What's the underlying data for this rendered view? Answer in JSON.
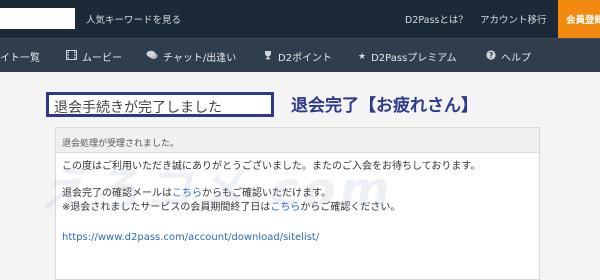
{
  "header": {
    "search": {
      "value": "",
      "placeholder": ""
    },
    "popular_keywords": "人気キーワードを見る",
    "about": "D2Passとは？",
    "account_migration": "アカウント移行",
    "register": "会員登録"
  },
  "nav": {
    "items": [
      {
        "label": "イト一覧",
        "icon": "list-icon"
      },
      {
        "label": "ムービー",
        "icon": "film-icon"
      },
      {
        "label": "チャット/出逢い",
        "icon": "chat-icon"
      },
      {
        "label": "D2ポイント",
        "icon": "trophy-icon"
      },
      {
        "label": "D2Passプレミアム",
        "icon": "star-icon"
      },
      {
        "label": "ヘルプ",
        "icon": "question-icon"
      }
    ]
  },
  "main": {
    "title_box": "退会手続きが完了しました",
    "caption": "退会完了【お疲れさん】",
    "watermark": "えろコメ.com",
    "panel": {
      "header": "退会処理が受理されました。",
      "line1": "この度はご利用いただき誠にありがとうございました。またのご入会をお待ちしております。",
      "line2_before": "退会完了の確認メールは",
      "line2_link": "こちら",
      "line2_after": "からもご確認いただけます。",
      "line3_before": "※退会されましたサービスの会員期間終了日は",
      "line3_link": "こちら",
      "line3_after": "からご確認ください。",
      "url": "https://www.d2pass.com/account/download/sitelist/"
    }
  },
  "colors": {
    "topbar": "#1c2936",
    "navbar": "#2f3d4c",
    "register": "#f28a0f",
    "accent": "#2d3a8c",
    "link": "#2a6ab8"
  }
}
